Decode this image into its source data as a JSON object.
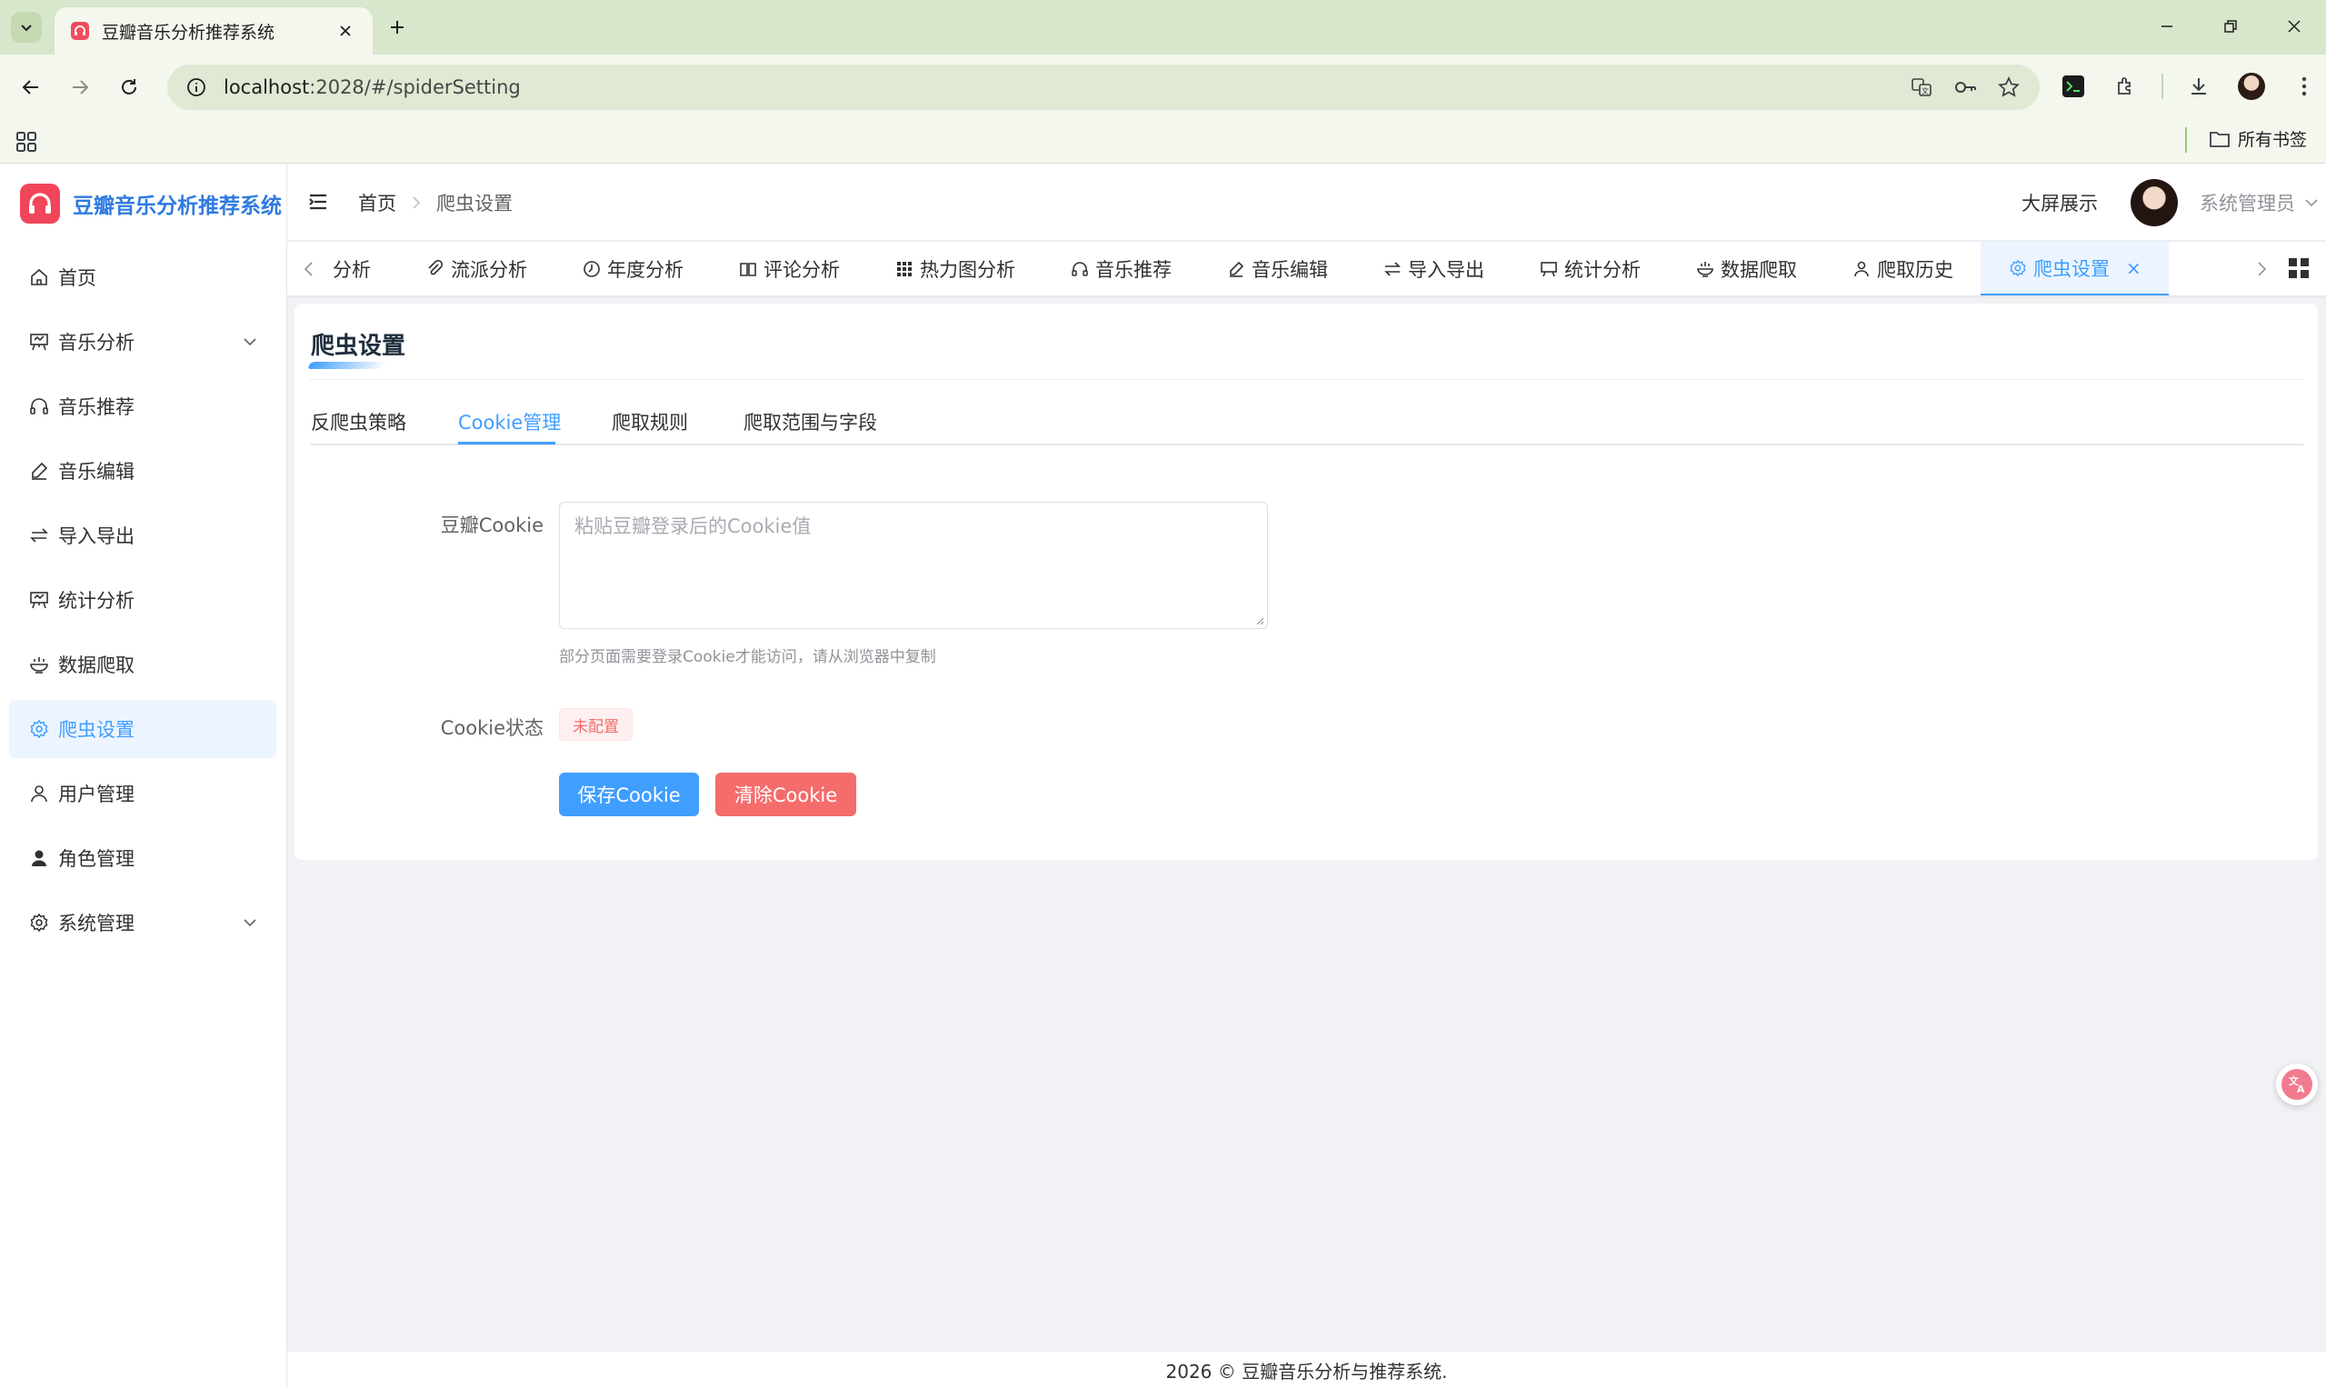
{
  "browser": {
    "tab_title": "豆瓣音乐分析推荐系统",
    "url_host": "localhost",
    "url_rest": ":2028/#/spiderSetting",
    "bookmarks_folder": "所有书签"
  },
  "app": {
    "brand_title": "豆瓣音乐分析推荐系统",
    "sidebar": {
      "items": [
        {
          "label": "首页",
          "icon": "home-icon"
        },
        {
          "label": "音乐分析",
          "icon": "presentation-icon",
          "expandable": true
        },
        {
          "label": "音乐推荐",
          "icon": "headphones-icon"
        },
        {
          "label": "音乐编辑",
          "icon": "edit-pen-icon"
        },
        {
          "label": "导入导出",
          "icon": "switch-arrows-icon"
        },
        {
          "label": "统计分析",
          "icon": "presentation-icon"
        },
        {
          "label": "数据爬取",
          "icon": "bowl-icon"
        },
        {
          "label": "爬虫设置",
          "icon": "gear-icon",
          "active": true
        },
        {
          "label": "用户管理",
          "icon": "user-icon"
        },
        {
          "label": "角色管理",
          "icon": "user-filled-icon"
        },
        {
          "label": "系统管理",
          "icon": "gear-icon",
          "expandable": true
        }
      ]
    },
    "navbar": {
      "breadcrumb_home": "首页",
      "breadcrumb_current": "爬虫设置",
      "big_screen": "大屏展示",
      "user_name": "系统管理员"
    },
    "tags": [
      {
        "label": "分析",
        "icon": ""
      },
      {
        "label": "流派分析",
        "icon": "paperclip-icon"
      },
      {
        "label": "年度分析",
        "icon": "clock-icon"
      },
      {
        "label": "评论分析",
        "icon": "book-icon"
      },
      {
        "label": "热力图分析",
        "icon": "grid-icon"
      },
      {
        "label": "音乐推荐",
        "icon": "headphones-icon"
      },
      {
        "label": "音乐编辑",
        "icon": "edit-pen-icon"
      },
      {
        "label": "导入导出",
        "icon": "switch-arrows-icon"
      },
      {
        "label": "统计分析",
        "icon": "presentation-icon"
      },
      {
        "label": "数据爬取",
        "icon": "bowl-icon"
      },
      {
        "label": "爬取历史",
        "icon": "user-icon"
      },
      {
        "label": "爬虫设置",
        "icon": "gear-icon",
        "active": true,
        "close": "×"
      }
    ],
    "page": {
      "title": "爬虫设置",
      "sub_tabs": [
        "反爬虫策略",
        "Cookie管理",
        "爬取规则",
        "爬取范围与字段"
      ],
      "active_sub_tab": "Cookie管理",
      "cookie_label": "豆瓣Cookie",
      "cookie_value": "",
      "cookie_placeholder": "粘贴豆瓣登录后的Cookie值",
      "cookie_hint": "部分页面需要登录Cookie才能访问，请从浏览器中复制",
      "status_label": "Cookie状态",
      "status_value": "未配置",
      "save_button": "保存Cookie",
      "clear_button": "清除Cookie"
    },
    "footer": "2026 © 豆瓣音乐分析与推荐系统."
  },
  "colors": {
    "primary": "#409eff",
    "danger": "#f56c6c",
    "brand_red": "#f0455a",
    "brand_text": "#2f7be0",
    "chrome_frame": "#d8e6cc"
  }
}
